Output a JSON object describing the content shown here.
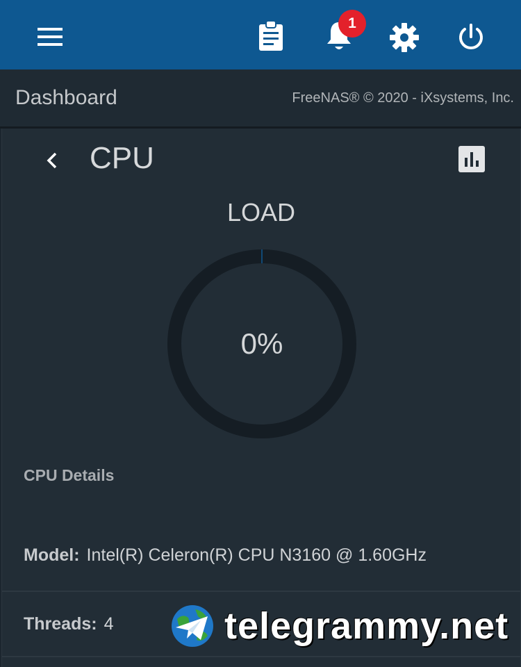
{
  "topbar": {
    "background": "#0e5891",
    "notification_count": "1",
    "icons": [
      "menu-icon",
      "clipboard-icon",
      "bell-icon",
      "gear-icon",
      "power-icon"
    ]
  },
  "header": {
    "title": "Dashboard",
    "copyright": "FreeNAS® © 2020 - iXsystems, Inc."
  },
  "cpu_card": {
    "title": "CPU",
    "load_label": "LOAD",
    "load_value": "0%",
    "load_fraction": 0.0,
    "details_heading": "CPU Details",
    "model_label": "Model:",
    "model_value": "Intel(R) Celeron(R) CPU N3160 @ 1.60GHz",
    "threads_label": "Threads:",
    "threads_value": "4"
  },
  "watermark": {
    "text": "telegrammy.net"
  }
}
